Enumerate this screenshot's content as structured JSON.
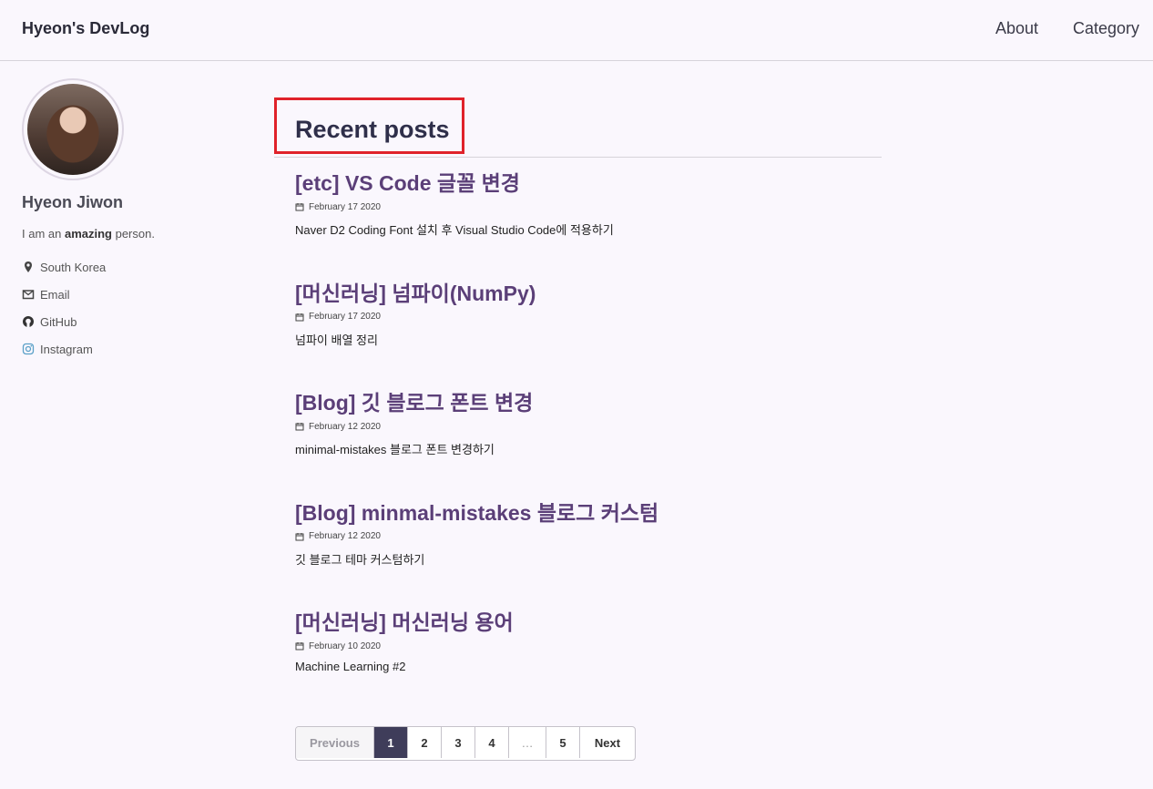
{
  "header": {
    "site_title": "Hyeon's DevLog",
    "nav": [
      {
        "label": "About"
      },
      {
        "label": "Category"
      }
    ]
  },
  "sidebar": {
    "author_name": "Hyeon Jiwon",
    "bio_prefix": "I am an ",
    "bio_bold": "amazing",
    "bio_suffix": " person.",
    "links": [
      {
        "label": "South Korea",
        "icon": "map-marker-icon"
      },
      {
        "label": "Email",
        "icon": "envelope-icon"
      },
      {
        "label": "GitHub",
        "icon": "github-icon"
      },
      {
        "label": "Instagram",
        "icon": "instagram-icon"
      }
    ]
  },
  "main": {
    "page_title": "Recent posts",
    "posts": [
      {
        "title": "[etc] VS Code 글꼴 변경",
        "date": "February 17 2020",
        "excerpt": "Naver D2 Coding Font 설치 후 Visual Studio Code에 적용하기"
      },
      {
        "title": "[머신러닝] 넘파이(NumPy)",
        "date": "February 17 2020",
        "excerpt": "넘파이 배열 정리"
      },
      {
        "title": "[Blog] 깃 블로그 폰트 변경",
        "date": "February 12 2020",
        "excerpt": "minimal-mistakes 블로그 폰트 변경하기"
      },
      {
        "title": "[Blog] minmal-mistakes 블로그 커스텀",
        "date": "February 12 2020",
        "excerpt": "깃 블로그 테마 커스텀하기"
      },
      {
        "title": "[머신러닝] 머신러닝 용어",
        "date": "February 10 2020",
        "excerpt": "Machine Learning #2"
      }
    ]
  },
  "pagination": {
    "previous": "Previous",
    "pages": [
      "1",
      "2",
      "3",
      "4",
      "…",
      "5"
    ],
    "current": "1",
    "next": "Next"
  },
  "colors": {
    "accent": "#5b3f78",
    "highlight_box": "#e0222a",
    "active_page": "#3f3d5a"
  }
}
